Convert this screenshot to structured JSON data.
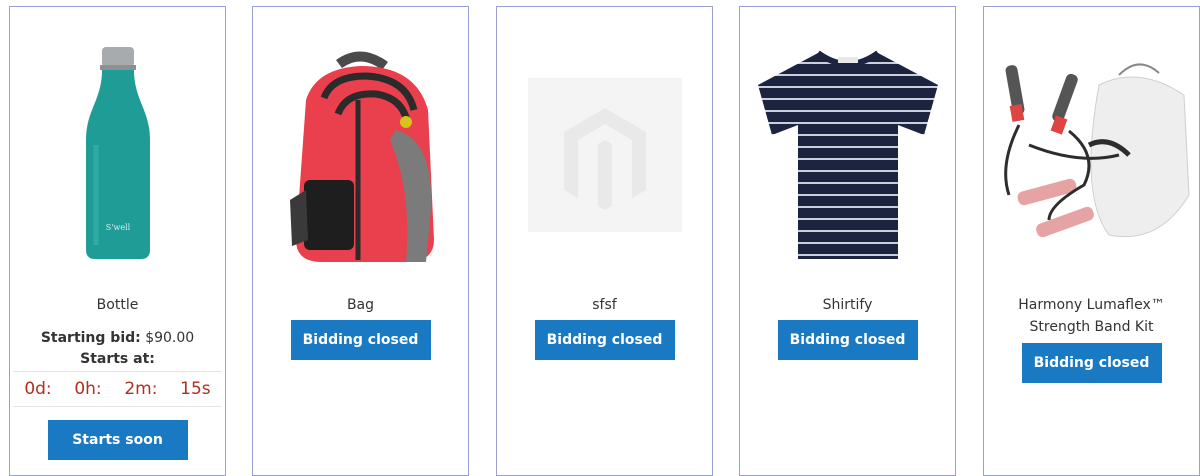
{
  "products": [
    {
      "name": "Bottle",
      "starting_bid_label": "Starting bid:",
      "starting_bid_value": "$90.00",
      "starts_at_label": "Starts at:",
      "countdown": {
        "days": "0d:",
        "hours": "0h:",
        "minutes": "2m:",
        "seconds": "15s"
      },
      "button_label": "Starts soon"
    },
    {
      "name": "Bag",
      "button_label": "Bidding closed"
    },
    {
      "name": "sfsf",
      "button_label": "Bidding closed"
    },
    {
      "name": "Shirtify",
      "button_label": "Bidding closed"
    },
    {
      "name": "Harmony Lumaflex™ Strength Band Kit",
      "button_label": "Bidding closed"
    }
  ],
  "colors": {
    "button_bg": "#1979c3",
    "button_text": "#ffffff",
    "card_border": "#9b9fd6",
    "countdown_text": "#b0301e"
  }
}
